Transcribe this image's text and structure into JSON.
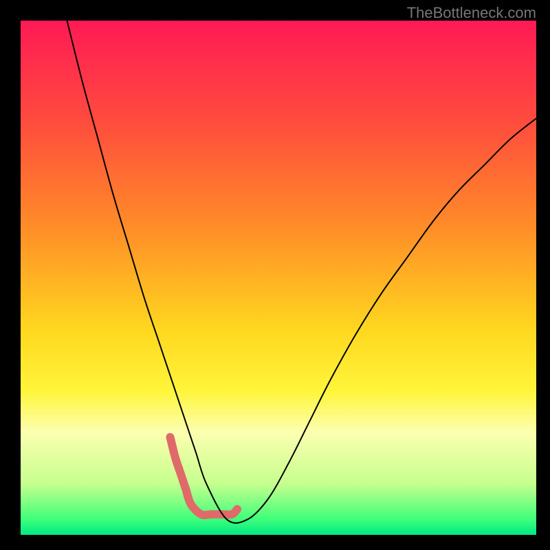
{
  "watermark": "TheBottleneck.com",
  "chart_data": {
    "type": "line",
    "title": "",
    "xlabel": "",
    "ylabel": "",
    "xlim": [
      0,
      100
    ],
    "ylim": [
      0,
      100
    ],
    "gradient_stops": [
      {
        "offset": 0,
        "color": "#ff1a55"
      },
      {
        "offset": 20,
        "color": "#ff4d3d"
      },
      {
        "offset": 40,
        "color": "#ff8c28"
      },
      {
        "offset": 60,
        "color": "#ffd71f"
      },
      {
        "offset": 72,
        "color": "#fff53a"
      },
      {
        "offset": 80,
        "color": "#fcffb0"
      },
      {
        "offset": 90,
        "color": "#c7ff8e"
      },
      {
        "offset": 97,
        "color": "#3eff7a"
      },
      {
        "offset": 100,
        "color": "#00e885"
      }
    ],
    "series": [
      {
        "name": "bottleneck-curve",
        "color": "#000000",
        "width": 2,
        "x": [
          9,
          12,
          15,
          18,
          21,
          24,
          27,
          30,
          32,
          34,
          36,
          40,
          44,
          48,
          52,
          56,
          60,
          65,
          70,
          75,
          80,
          85,
          90,
          95,
          100
        ],
        "y": [
          100,
          88,
          77,
          66,
          56,
          46,
          37,
          28,
          22,
          16,
          10,
          3,
          3,
          7,
          14,
          22,
          30,
          39,
          47,
          54,
          61,
          67,
          72,
          77,
          81
        ]
      },
      {
        "name": "highlight-region",
        "color": "#e06a6a",
        "width": 12,
        "cap": "round",
        "x": [
          29,
          30,
          31,
          32,
          33,
          35,
          37,
          39,
          41,
          42
        ],
        "y": [
          19,
          15,
          12,
          9,
          6,
          4,
          4,
          4,
          4,
          5
        ]
      }
    ],
    "annotations": []
  }
}
